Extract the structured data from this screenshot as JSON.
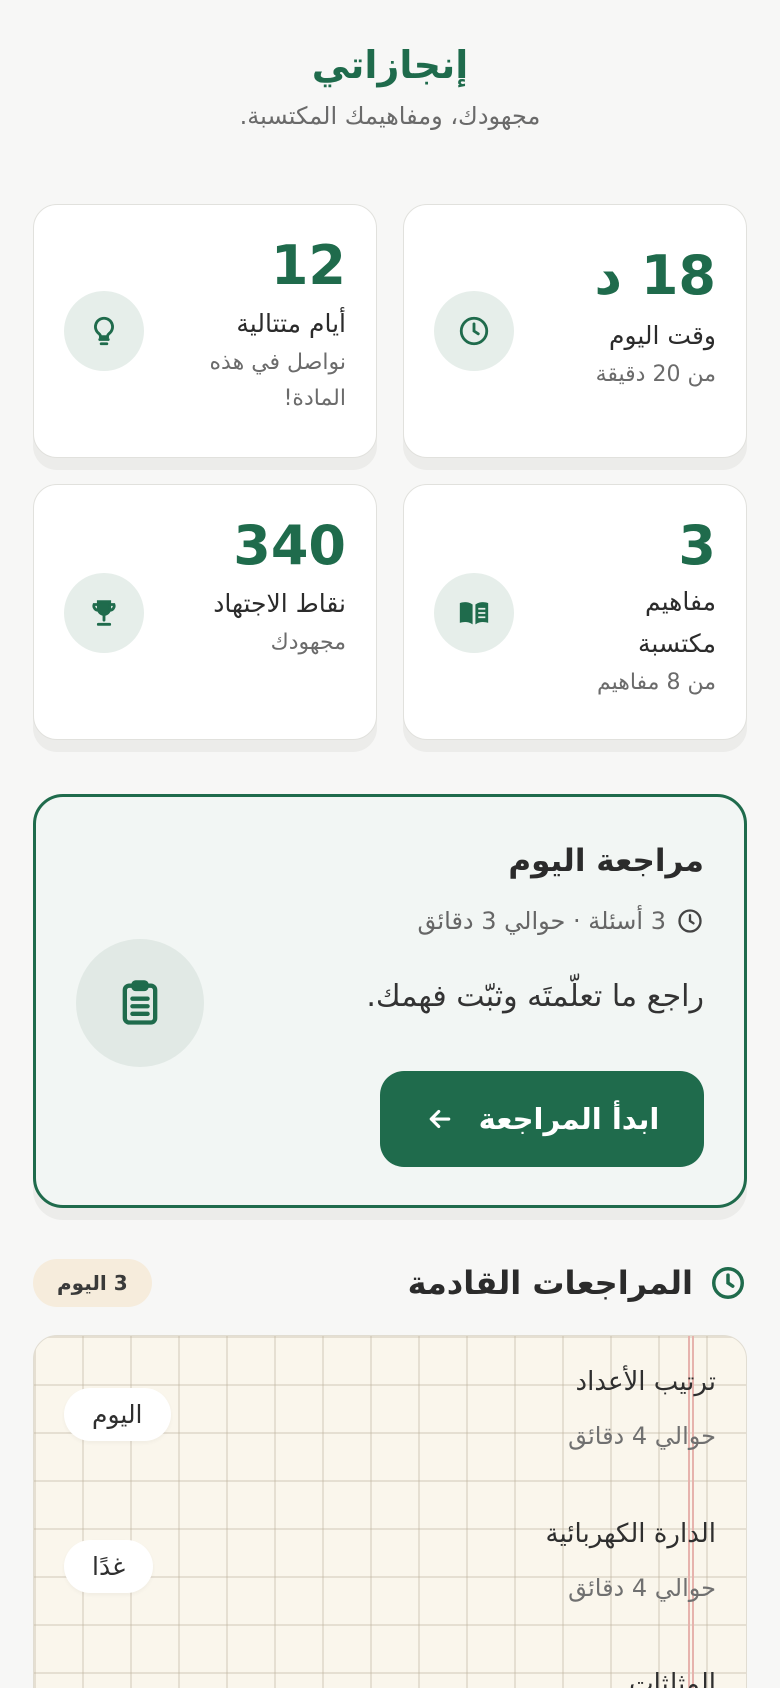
{
  "header": {
    "title": "إنجازاتي",
    "subtitle": "مجهودك، ومفاهيمك المكتسبة."
  },
  "stats": [
    {
      "value": "18 د",
      "title": "وقت اليوم",
      "sub": "من 20 دقيقة",
      "icon": "clock-icon"
    },
    {
      "value": "12",
      "title": "أيام متتالية",
      "sub": "نواصل في هذه المادة!",
      "icon": "lightbulb-icon"
    },
    {
      "value": "3",
      "title": "مفاهيم مكتسبة",
      "sub": "من 8 مفاهيم",
      "icon": "book-icon"
    },
    {
      "value": "340",
      "title": "نقاط الاجتهاد",
      "sub": "مجهودك",
      "icon": "trophy-icon"
    }
  ],
  "review": {
    "title": "مراجعة اليوم",
    "meta": "3 أسئلة · حوالي 3 دقائق",
    "description": "راجع ما تعلّمتَه وثبّت فهمك.",
    "button_label": "ابدأ المراجعة"
  },
  "upcoming": {
    "title": "المراجعات القادمة",
    "badge": "3 اليوم",
    "items": [
      {
        "name": "ترتيب الأعداد",
        "time": "حوالي 4 دقائق",
        "day": "اليوم"
      },
      {
        "name": "الدارة الكهربائية",
        "time": "حوالي 4 دقائق",
        "day": "غدًا"
      },
      {
        "name": "المثلثات",
        "time": "",
        "day": ""
      }
    ]
  },
  "colors": {
    "accent": "#1f6b4c",
    "icon_bg": "#e6eeea",
    "badge_bg": "#f6ecdc",
    "paper_bg": "#faf6ec"
  }
}
